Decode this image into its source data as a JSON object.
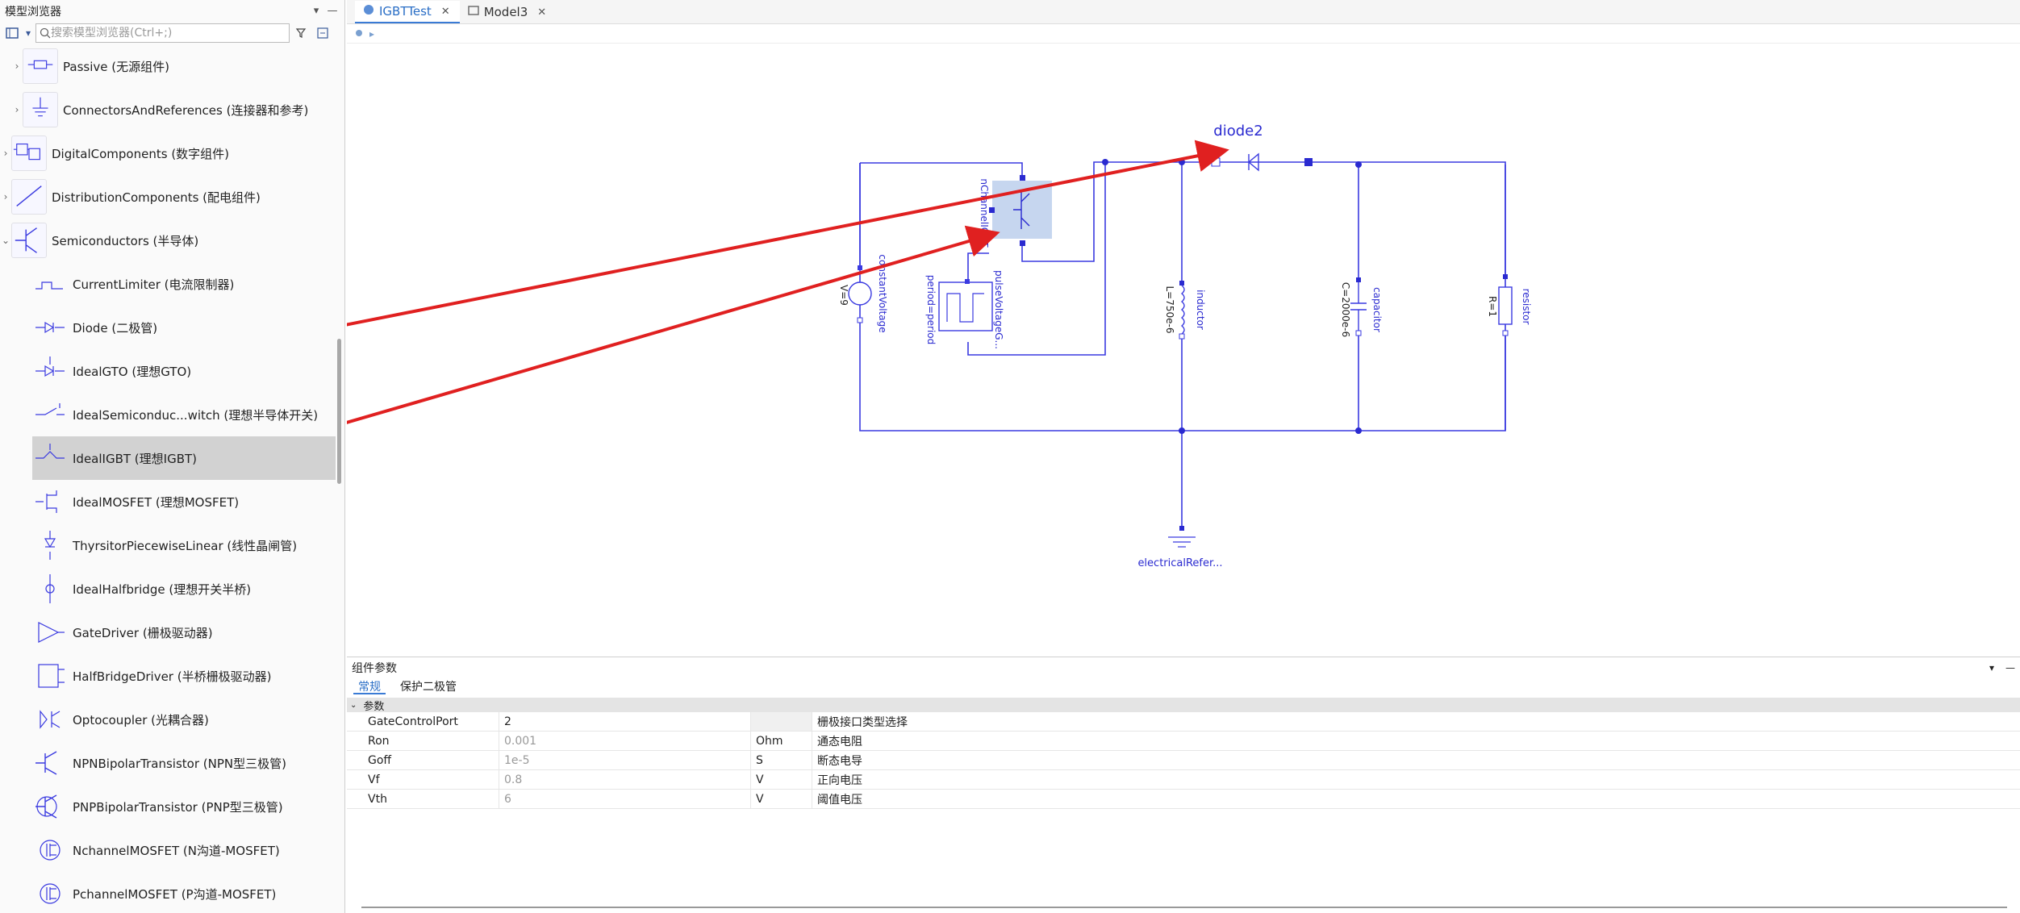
{
  "browser": {
    "title": "模型浏览器",
    "search_placeholder": "搜索模型浏览器(Ctrl+;)"
  },
  "tree": [
    {
      "label": "Passive (无源组件)",
      "level": 1,
      "expand": "›",
      "icon": "passive-icon"
    },
    {
      "label": "ConnectorsAndReferences (连接器和参考)",
      "level": 1,
      "expand": "›",
      "icon": "ground-icon"
    },
    {
      "label": "DigitalComponents (数字组件)",
      "level": 0,
      "expand": "›",
      "icon": "digital-icon"
    },
    {
      "label": "DistributionComponents (配电组件)",
      "level": 0,
      "expand": "›",
      "icon": "distribution-icon"
    },
    {
      "label": "Semiconductors (半导体)",
      "level": 0,
      "expand": "⌄",
      "icon": "transistor-icon"
    },
    {
      "label": "CurrentLimiter (电流限制器)",
      "level": 1,
      "expand": "",
      "icon": "current-limiter-icon"
    },
    {
      "label": "Diode (二极管)",
      "level": 1,
      "expand": "",
      "icon": "diode-icon"
    },
    {
      "label": "IdealGTO (理想GTO)",
      "level": 1,
      "expand": "",
      "icon": "gto-icon"
    },
    {
      "label": "IdealSemiconduc...witch (理想半导体开关)",
      "level": 1,
      "expand": "",
      "icon": "switch-icon"
    },
    {
      "label": "IdealIGBT (理想IGBT)",
      "level": 1,
      "expand": "",
      "icon": "igbt-icon",
      "selected": true
    },
    {
      "label": "IdealMOSFET (理想MOSFET)",
      "level": 1,
      "expand": "",
      "icon": "mosfet-icon"
    },
    {
      "label": "ThyrsitorPiecewiseLinear (线性晶闸管)",
      "level": 1,
      "expand": "",
      "icon": "thyristor-icon"
    },
    {
      "label": "IdealHalfbridge (理想开关半桥)",
      "level": 1,
      "expand": "",
      "icon": "halfbridge-icon"
    },
    {
      "label": "GateDriver (栅极驱动器)",
      "level": 1,
      "expand": "",
      "icon": "gate-driver-icon"
    },
    {
      "label": "HalfBridgeDriver (半桥栅极驱动器)",
      "level": 1,
      "expand": "",
      "icon": "halfbridge-driver-icon"
    },
    {
      "label": "Optocoupler (光耦合器)",
      "level": 1,
      "expand": "",
      "icon": "optocoupler-icon"
    },
    {
      "label": "NPNBipolarTransistor (NPN型三极管)",
      "level": 1,
      "expand": "",
      "icon": "npn-icon"
    },
    {
      "label": "PNPBipolarTransistor (PNP型三极管)",
      "level": 1,
      "expand": "",
      "icon": "pnp-icon"
    },
    {
      "label": "NchannelMOSFET (N沟道-MOSFET)",
      "level": 1,
      "expand": "",
      "icon": "nmos-icon"
    },
    {
      "label": "PchannelMOSFET (P沟道-MOSFET)",
      "level": 1,
      "expand": "",
      "icon": "pmos-icon"
    }
  ],
  "tabs": [
    {
      "label": "IGBTTest",
      "active": true
    },
    {
      "label": "Model3",
      "active": false
    }
  ],
  "diagram": {
    "labels": {
      "diode2": "diode2",
      "nchannel": "nChannelIGBT",
      "constant_voltage": "constantVoltage",
      "constant_v_param": "V=9",
      "pulse_voltage": "pulseVoltageG...",
      "pulse_period": "period=period",
      "inductor": "inductor",
      "inductor_param": "L=750e-6",
      "capacitor": "capacitor",
      "capacitor_param": "C=2000e-6",
      "resistor": "resistor",
      "resistor_param": "R=1",
      "ground": "electricalRefer..."
    },
    "wire_color": "#3a3ae0",
    "arrow_color": "#e02020"
  },
  "params": {
    "title": "组件参数",
    "tabs": [
      "常规",
      "保护二极管"
    ],
    "group": "参数",
    "rows": [
      {
        "name": "GateControlPort",
        "value": "2",
        "unit": "",
        "desc": "栅极接口类型选择",
        "editable": true
      },
      {
        "name": "Ron",
        "value": "0.001",
        "unit": "Ohm",
        "desc": "通态电阻",
        "editable": false
      },
      {
        "name": "Goff",
        "value": "1e-5",
        "unit": "S",
        "desc": "断态电导",
        "editable": false
      },
      {
        "name": "Vf",
        "value": "0.8",
        "unit": "V",
        "desc": "正向电压",
        "editable": false
      },
      {
        "name": "Vth",
        "value": "6",
        "unit": "V",
        "desc": "阈值电压",
        "editable": false
      }
    ]
  }
}
